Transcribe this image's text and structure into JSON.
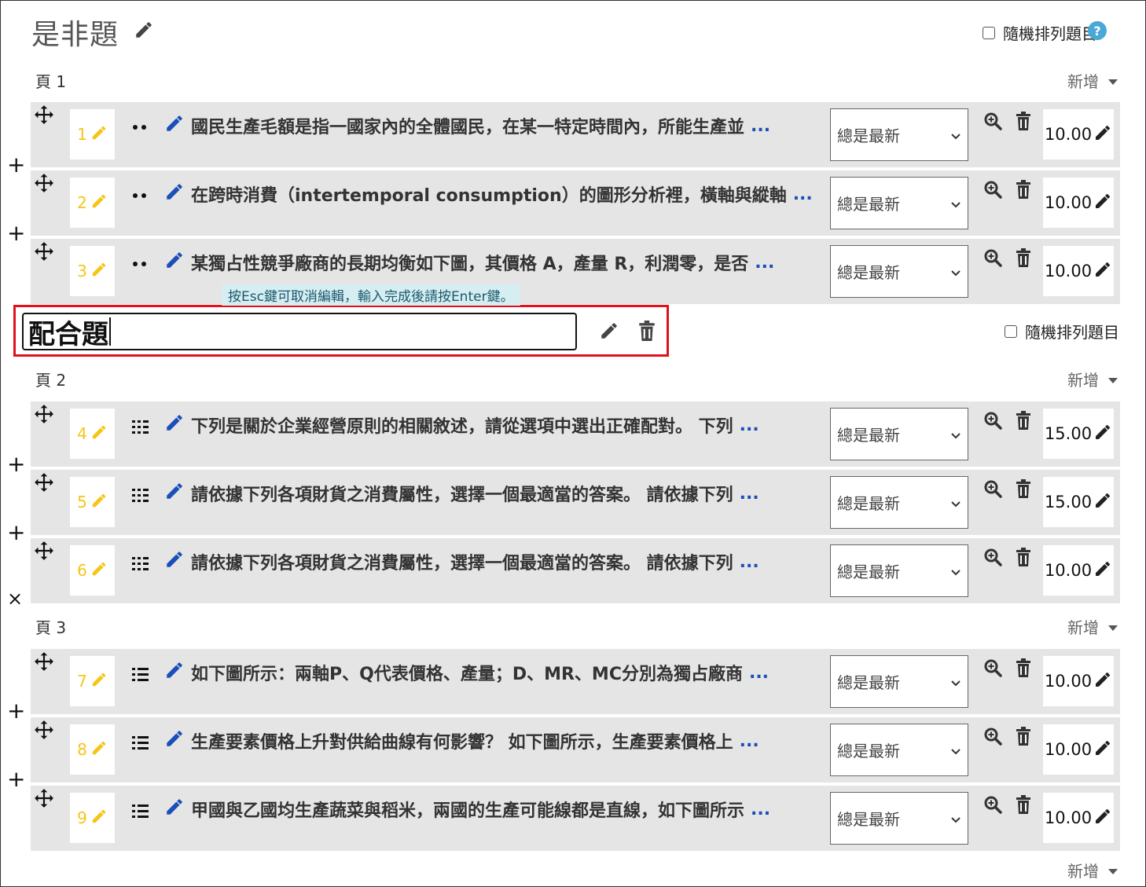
{
  "header": {
    "title": "是非題",
    "shuffle_label": "隨機排列題目",
    "help_icon": "question-circle-icon"
  },
  "section_editor": {
    "value": "配合題",
    "shuffle_label": "隨機排列題目"
  },
  "hint": "按Esc鍵可取消編輯，輸入完成後請按Enter鍵。",
  "add_label": "新增",
  "pages": [
    {
      "label": "頁 1"
    },
    {
      "label": "頁 2"
    },
    {
      "label": "頁 3"
    }
  ],
  "questions": [
    {
      "num": "1",
      "type_icon": "truefalse-icon",
      "text": "國民生產毛額是指一國家內的全體國民，在某一特定時間內，所能生產並",
      "version": "總是最新",
      "mark": "10.00"
    },
    {
      "num": "2",
      "type_icon": "truefalse-icon",
      "text": "在跨時消費（intertemporal consumption）的圖形分析裡，橫軸與縱軸",
      "version": "總是最新",
      "mark": "10.00"
    },
    {
      "num": "3",
      "type_icon": "truefalse-icon",
      "text": "某獨占性競爭廠商的長期均衡如下圖，其價格 A，產量 R，利潤零，是否",
      "version": "總是最新",
      "mark": "10.00"
    },
    {
      "num": "4",
      "type_icon": "matching-icon",
      "text": "下列是關於企業經營原則的相關敘述，請從選項中選出正確配對。 下列",
      "version": "總是最新",
      "mark": "15.00"
    },
    {
      "num": "5",
      "type_icon": "matching-icon",
      "text": "請依據下列各項財貨之消費屬性，選擇一個最適當的答案。 請依據下列",
      "version": "總是最新",
      "mark": "15.00"
    },
    {
      "num": "6",
      "type_icon": "matching-icon",
      "text": "請依據下列各項財貨之消費屬性，選擇一個最適當的答案。 請依據下列",
      "version": "總是最新",
      "mark": "10.00"
    },
    {
      "num": "7",
      "type_icon": "multichoice-icon",
      "text": "如下圖所示：兩軸P、Q代表價格、產量；D、MR、MC分別為獨占廠商",
      "version": "總是最新",
      "mark": "10.00"
    },
    {
      "num": "8",
      "type_icon": "multichoice-icon",
      "text": "生產要素價格上升對供給曲線有何影響？ 如下圖所示，生產要素價格上",
      "version": "總是最新",
      "mark": "10.00"
    },
    {
      "num": "9",
      "type_icon": "multichoice-icon",
      "text": "甲國與乙國均生產蔬菜與稻米，兩國的生產可能線都是直線，如下圖所示",
      "version": "總是最新",
      "mark": "10.00"
    }
  ],
  "ellipsis": "...",
  "colors": {
    "accent": "#1a4fb8",
    "number": "#f5c518",
    "highlight_border": "#e0111a",
    "row_bg": "#e5e5e5"
  }
}
